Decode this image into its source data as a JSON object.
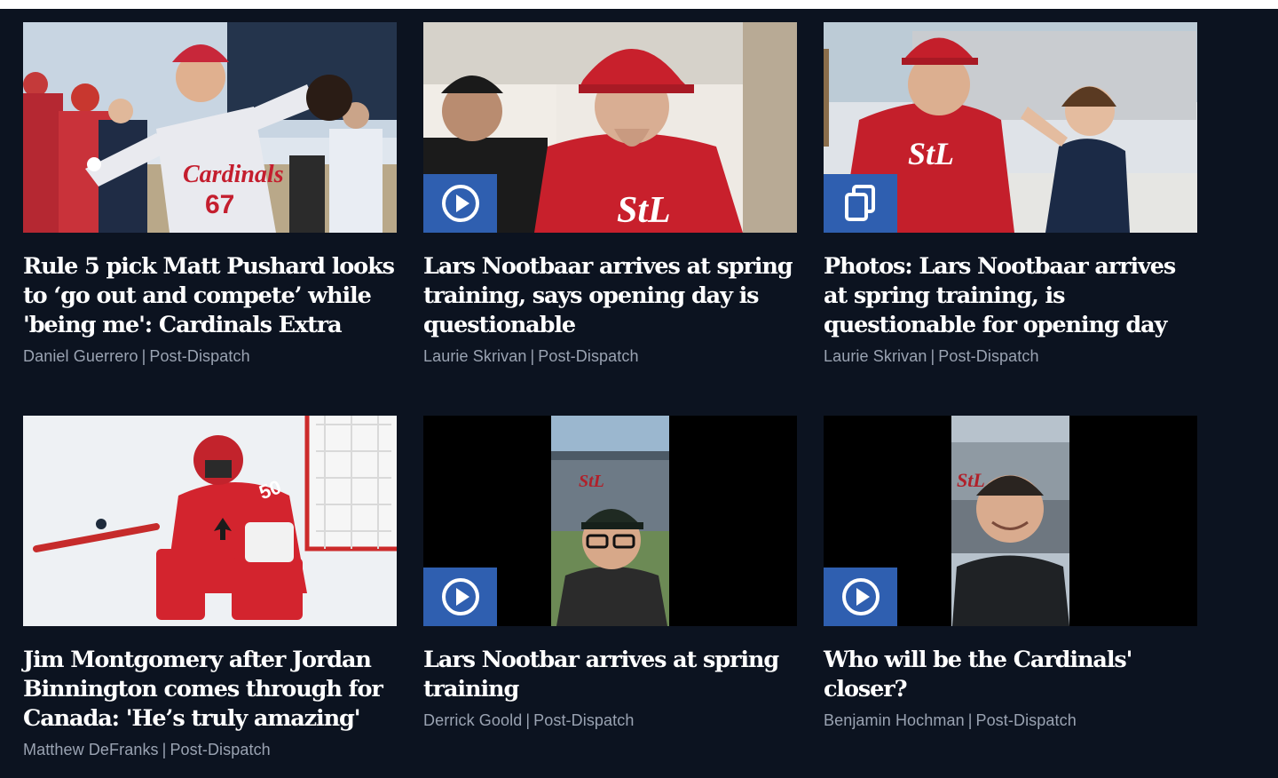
{
  "articles": [
    {
      "headline": "Rule 5 pick Matt Pushard looks to ‘go out and compete’ while 'being me': Cardinals Extra",
      "author": "Daniel Guerrero",
      "separator": "|",
      "outlet": "Post-Dispatch",
      "media": "photo",
      "image_alt": "Cardinals pitcher number 67 throwing"
    },
    {
      "headline": "Lars Nootbaar arrives at spring training, says opening day is questionable",
      "author": "Laurie Skrivan",
      "separator": "|",
      "outlet": "Post-Dispatch",
      "media": "video",
      "badge_icon": "play-icon"
    },
    {
      "headline": "Photos: Lars Nootbaar arrives at spring training, is questionable for opening day",
      "author": "Laurie Skrivan",
      "separator": "|",
      "outlet": "Post-Dispatch",
      "media": "gallery",
      "badge_icon": "gallery-icon"
    },
    {
      "headline": "Jim Montgomery after Jordan Binnington comes through for Canada: 'He’s truly amazing'",
      "author": "Matthew DeFranks",
      "separator": "|",
      "outlet": "Post-Dispatch",
      "media": "photo",
      "jersey_number": "50"
    },
    {
      "headline": "Lars Nootbar arrives at spring training",
      "author": "Derrick Goold",
      "separator": "|",
      "outlet": "Post-Dispatch",
      "media": "video",
      "badge_icon": "play-icon"
    },
    {
      "headline": "Who will be the Cardinals' closer?",
      "author": "Benjamin Hochman",
      "separator": "|",
      "outlet": "Post-Dispatch",
      "media": "video",
      "badge_icon": "play-icon"
    }
  ],
  "colors": {
    "background": "#0c1320",
    "badge": "#2f5fb0",
    "headline": "#ffffff",
    "byline": "#9aa3b2",
    "cardinals_red": "#d4252f"
  }
}
